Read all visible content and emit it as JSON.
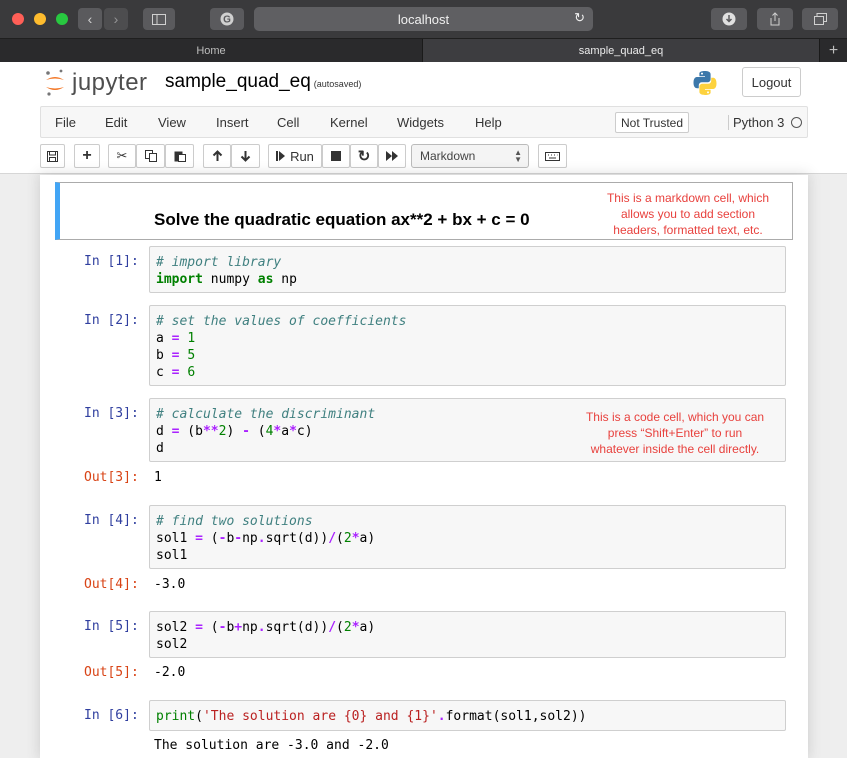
{
  "browser": {
    "url": "localhost",
    "tabs": [
      {
        "label": "Home"
      },
      {
        "label": "sample_quad_eq"
      }
    ]
  },
  "header": {
    "logo_text": "jupyter",
    "notebook_name": "sample_quad_eq",
    "autosave": "(autosaved)",
    "logout_label": "Logout"
  },
  "menu": {
    "items": [
      "File",
      "Edit",
      "View",
      "Insert",
      "Cell",
      "Kernel",
      "Widgets",
      "Help"
    ],
    "trusted": "Not Trusted",
    "kernel": "Python 3"
  },
  "toolbar": {
    "run_label": "Run",
    "cell_type": "Markdown"
  },
  "markdown_cell": {
    "heading": "Solve the quadratic equation ax**2 + bx + c = 0"
  },
  "annotations": {
    "markdown_note": "This is a markdown cell, which allows you to add section headers, formatted text, etc.",
    "markdown_note_lines": [
      "This is a markdown cell, which",
      "allows you to add section",
      "headers, formatted text, etc."
    ],
    "code_note": "This is a code cell, which you can press “Shift+Enter” to run whatever inside the cell directly.",
    "code_note_lines": [
      "This is a code cell, which you can",
      "press “Shift+Enter” to run",
      "whatever inside the cell directly."
    ]
  },
  "cells": [
    {
      "in_prompt": "In [1]:",
      "lines": [
        "# import library",
        "import numpy as np"
      ]
    },
    {
      "in_prompt": "In [2]:",
      "lines": [
        "# set the values of coefficients",
        "a = 1",
        "b = 5",
        "c = 6"
      ]
    },
    {
      "in_prompt": "In [3]:",
      "lines": [
        "# calculate the discriminant",
        "d = (b**2) - (4*a*c)",
        "d"
      ],
      "out_prompt": "Out[3]:",
      "output": "1"
    },
    {
      "in_prompt": "In [4]:",
      "lines": [
        "# find two solutions",
        "sol1 = (-b-np.sqrt(d))/(2*a)",
        "sol1"
      ],
      "out_prompt": "Out[4]:",
      "output": "-3.0"
    },
    {
      "in_prompt": "In [5]:",
      "lines": [
        "sol2 = (-b+np.sqrt(d))/(2*a)",
        "sol2"
      ],
      "out_prompt": "Out[5]:",
      "output": "-2.0"
    },
    {
      "in_prompt": "In [6]:",
      "lines": [
        "print('The solution are {0} and {1}'.format(sol1,sol2))"
      ],
      "output": "The solution are -3.0 and -2.0"
    }
  ],
  "colors": {
    "titlebar": "#3a3a3c",
    "prompt_in": "#303f9f",
    "prompt_out": "#d84315",
    "annotation": "#e8413d",
    "md_selected_border": "#42a5f5"
  }
}
